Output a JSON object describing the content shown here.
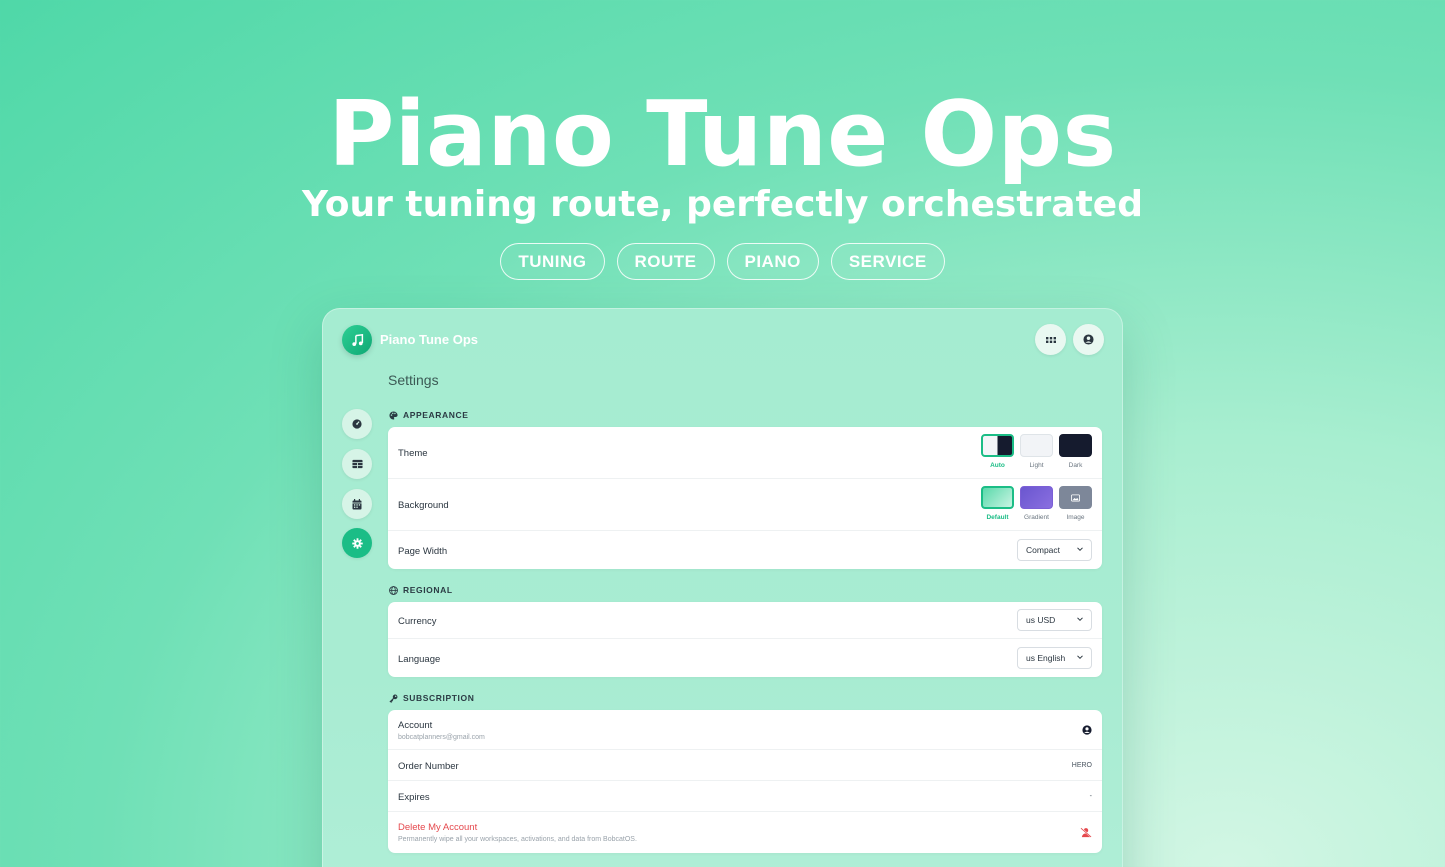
{
  "hero": {
    "title": "Piano Tune Ops",
    "subtitle": "Your tuning route, perfectly orchestrated",
    "tags": [
      "TUNING",
      "ROUTE",
      "PIANO",
      "SERVICE"
    ]
  },
  "app": {
    "name": "Piano Tune Ops",
    "logo_icon": "music-note-icon",
    "top_actions": [
      "apps-grid-icon",
      "user-circle-icon"
    ]
  },
  "page": {
    "title": "Settings"
  },
  "sidebar": {
    "items": [
      {
        "icon": "dashboard-gauge-icon",
        "active": false
      },
      {
        "icon": "table-icon",
        "active": false
      },
      {
        "icon": "calendar-icon",
        "active": false
      },
      {
        "icon": "gear-icon",
        "active": true
      }
    ]
  },
  "appearance": {
    "section_title": "APPEARANCE",
    "theme": {
      "label": "Theme",
      "options": [
        {
          "label": "Auto",
          "selected": true
        },
        {
          "label": "Light",
          "selected": false
        },
        {
          "label": "Dark",
          "selected": false
        }
      ]
    },
    "background": {
      "label": "Background",
      "options": [
        {
          "label": "Default",
          "selected": true
        },
        {
          "label": "Gradient",
          "selected": false
        },
        {
          "label": "Image",
          "selected": false
        }
      ]
    },
    "page_width": {
      "label": "Page Width",
      "value": "Compact"
    }
  },
  "regional": {
    "section_title": "REGIONAL",
    "currency": {
      "label": "Currency",
      "value": "us USD"
    },
    "language": {
      "label": "Language",
      "value": "us English"
    }
  },
  "subscription": {
    "section_title": "SUBSCRIPTION",
    "account": {
      "label": "Account",
      "email": "bobcatplanners@gmail.com"
    },
    "order_number": {
      "label": "Order Number",
      "value": "HERO"
    },
    "expires": {
      "label": "Expires",
      "value": "-"
    },
    "delete": {
      "label": "Delete My Account",
      "description": "Permanently wipe all your workspaces, activations, and data from BobcatOS."
    }
  },
  "colors": {
    "accent": "#1bbd86",
    "danger": "#e5484d",
    "dark_swatch": "#151b2e",
    "gradient_swatch": "#7b5fd6"
  }
}
